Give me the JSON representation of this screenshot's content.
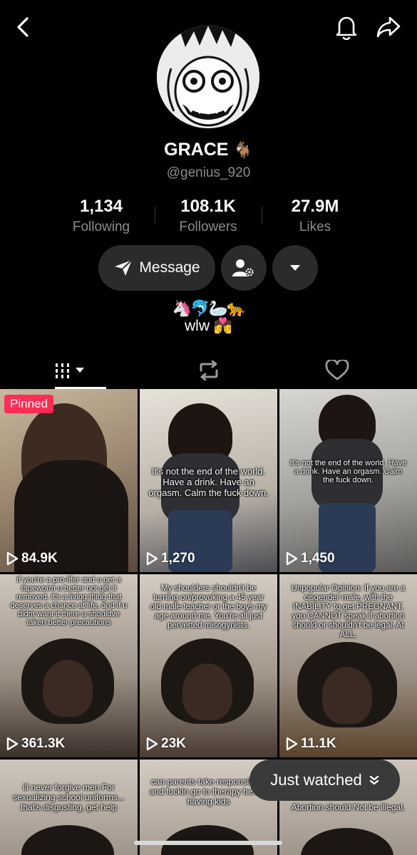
{
  "profile": {
    "name": "GRACE",
    "name_emoji": "🐐",
    "handle": "@genius_920",
    "stats": [
      {
        "value": "1,134",
        "label": "Following"
      },
      {
        "value": "108.1K",
        "label": "Followers"
      },
      {
        "value": "27.9M",
        "label": "Likes"
      }
    ],
    "bio_emojis": "🦄🐬🦢🐆",
    "bio_text": "wlw 💏"
  },
  "actions": {
    "message_label": "Message"
  },
  "tabs": {
    "videos_icon": "grid-icon",
    "reposts_icon": "repost-icon",
    "liked_icon": "heart-icon"
  },
  "videos": [
    {
      "views": "84.9K",
      "badge": "Pinned",
      "caption": ""
    },
    {
      "views": "1,270",
      "caption": "It's not the end of the world. Have a drink. Have an orgasm. Calm the fuck down."
    },
    {
      "views": "1,450",
      "caption": "It's not the end of the world. Have a drink. Have an orgasm. Calm the fuck down."
    },
    {
      "views": "361.3K",
      "caption": "If you're a pro-lifer and u get a tapeworm u better not get it removed. it's a living thing that deserves a chance at life, and if u didnt want it there u shouldve taken better precautions"
    },
    {
      "views": "23K",
      "caption": "My shoulders shouldn't be turning on/provoking a 45 year old male teacher or the boys my age around me. You're all just perverted misogynists."
    },
    {
      "views": "11.1K",
      "caption": "Unpopular Opinion: If you are a cisgender male, with the INABILITY to get PREGNANT, you CANNOT speak if abortion should or shouldn't be legal. At ALL."
    },
    {
      "views": "",
      "caption": "ill never forgive men For sexualizing school uniforms... that's disgusting, get help"
    },
    {
      "views": "",
      "caption": "can parents take responsibility and fuckin go to therapy before having kids"
    },
    {
      "views": "",
      "caption": "Abortion should Not be illegal."
    }
  ],
  "overlay": {
    "just_watched": "Just watched"
  },
  "colors": {
    "background": "#000000",
    "pill": "#2b2b2b",
    "muted_text": "#8c8c8c",
    "pinned": "#fe2c55"
  }
}
